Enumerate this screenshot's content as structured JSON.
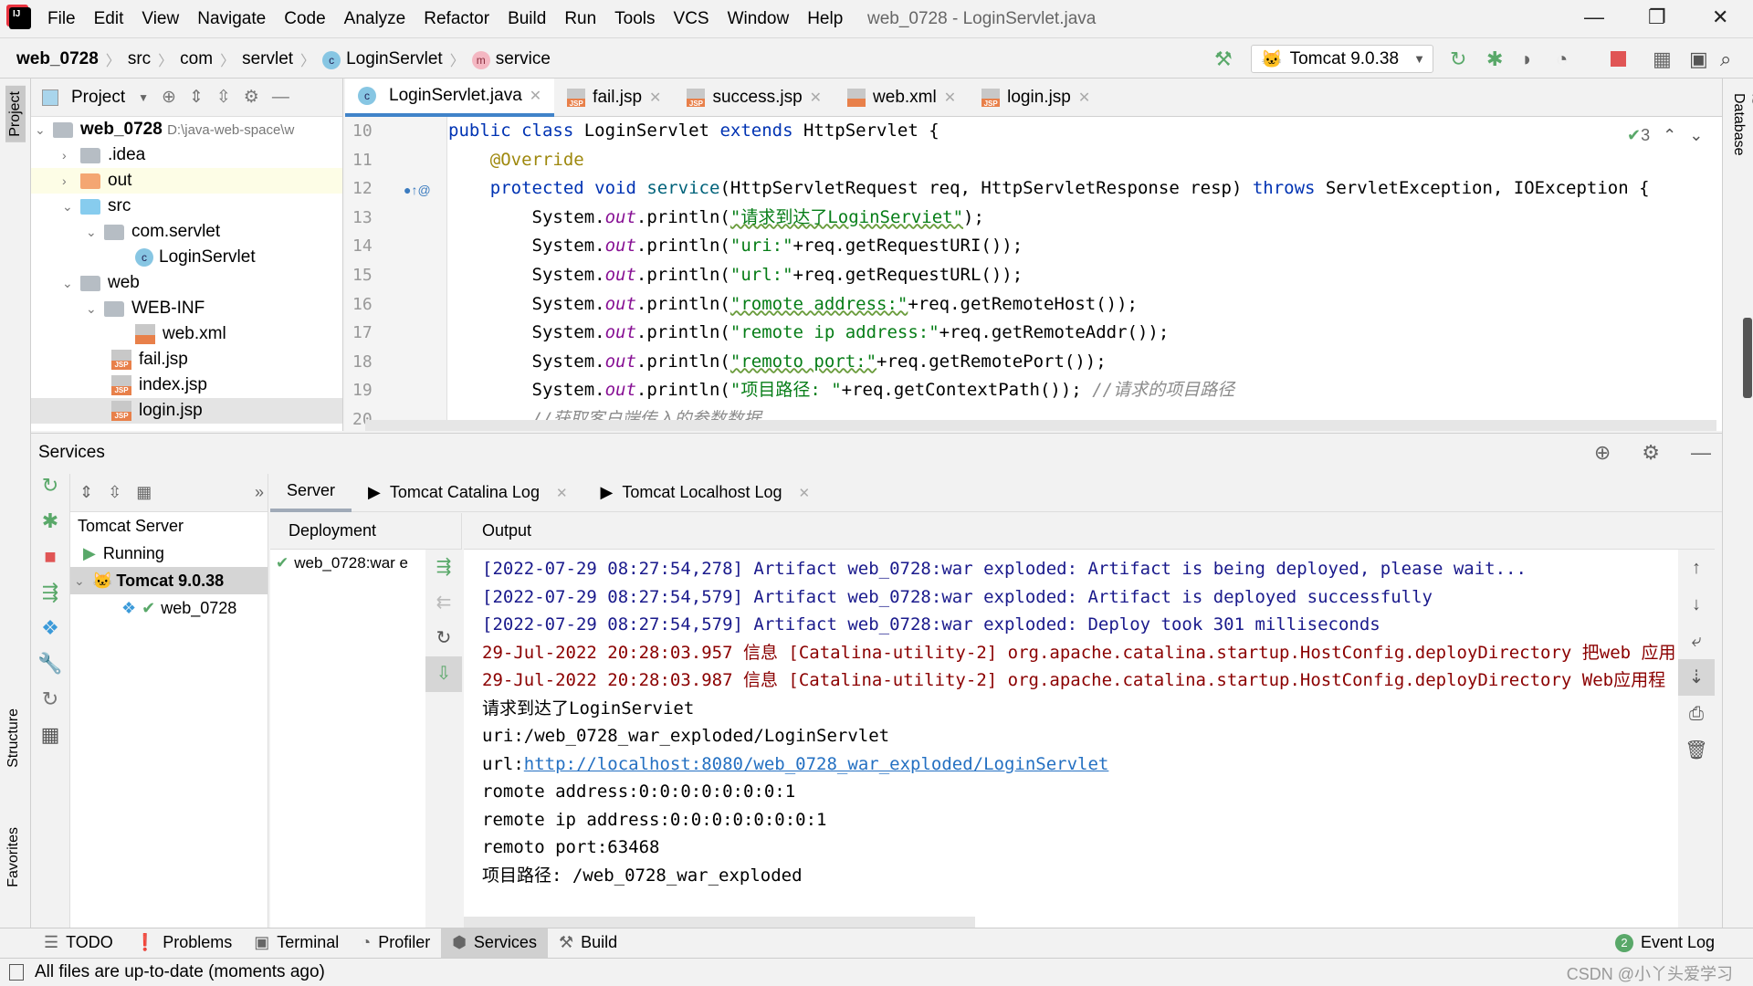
{
  "window": {
    "title": "web_0728 - LoginServlet.java"
  },
  "menu": [
    "File",
    "Edit",
    "View",
    "Navigate",
    "Code",
    "Analyze",
    "Refactor",
    "Build",
    "Run",
    "Tools",
    "VCS",
    "Window",
    "Help"
  ],
  "breadcrumb": [
    "web_0728",
    "src",
    "com",
    "servlet",
    "LoginServlet",
    "service"
  ],
  "run_config": "Tomcat 9.0.38",
  "project": {
    "header": "Project",
    "root": "web_0728",
    "root_path": "D:\\java-web-space\\w",
    "items": [
      ".idea",
      "out",
      "src",
      "com.servlet",
      "LoginServlet",
      "web",
      "WEB-INF",
      "web.xml",
      "fail.jsp",
      "index.jsp",
      "login.jsp"
    ]
  },
  "editor": {
    "tabs": [
      "LoginServlet.java",
      "fail.jsp",
      "success.jsp",
      "web.xml",
      "login.jsp"
    ],
    "inspection_count": "3",
    "line_numbers": [
      "10",
      "11",
      "12",
      "13",
      "14",
      "15",
      "16",
      "17",
      "18",
      "19",
      "20"
    ],
    "lines": [
      [
        [
          "kw",
          "public class "
        ],
        [
          "",
          "LoginServlet "
        ],
        [
          "kw",
          "extends "
        ],
        [
          "",
          "HttpServlet {"
        ]
      ],
      [
        [
          "",
          "    "
        ],
        [
          "ann",
          "@Override"
        ]
      ],
      [
        [
          "",
          "    "
        ],
        [
          "kw",
          "protected void "
        ],
        [
          "fn",
          "service"
        ],
        [
          "",
          "(HttpServletRequest req, HttpServletResponse resp) "
        ],
        [
          "kw",
          "throws "
        ],
        [
          "",
          "ServletException, IOException {"
        ]
      ],
      [
        [
          "",
          "        System."
        ],
        [
          "fld",
          "out"
        ],
        [
          "",
          ".println("
        ],
        [
          "st",
          "\"请求到达了LoginServiet\""
        ],
        [
          "",
          ");"
        ]
      ],
      [
        [
          "",
          "        System."
        ],
        [
          "fld",
          "out"
        ],
        [
          "",
          ".println("
        ],
        [
          "st",
          "\"uri:\""
        ],
        [
          "",
          "+req.getRequestURI());"
        ]
      ],
      [
        [
          "",
          "        System."
        ],
        [
          "fld",
          "out"
        ],
        [
          "",
          ".println("
        ],
        [
          "st",
          "\"url:\""
        ],
        [
          "",
          "+req.getRequestURL());"
        ]
      ],
      [
        [
          "",
          "        System."
        ],
        [
          "fld",
          "out"
        ],
        [
          "",
          ".println("
        ],
        [
          "st",
          "\"romote address:\""
        ],
        [
          "",
          "+req.getRemoteHost());"
        ]
      ],
      [
        [
          "",
          "        System."
        ],
        [
          "fld",
          "out"
        ],
        [
          "",
          ".println("
        ],
        [
          "st",
          "\"remote ip address:\""
        ],
        [
          "",
          "+req.getRemoteAddr());"
        ]
      ],
      [
        [
          "",
          "        System."
        ],
        [
          "fld",
          "out"
        ],
        [
          "",
          ".println("
        ],
        [
          "st",
          "\"remoto port:\""
        ],
        [
          "",
          "+req.getRemotePort());"
        ]
      ],
      [
        [
          "",
          "        System."
        ],
        [
          "fld",
          "out"
        ],
        [
          "",
          ".println("
        ],
        [
          "st",
          "\"项目路径: \""
        ],
        [
          "",
          "+req.getContextPath()); "
        ],
        [
          "cm",
          "//请求的项目路径"
        ]
      ],
      [
        [
          "",
          "        "
        ],
        [
          "cm",
          "//获取客户端传入的参数数据"
        ]
      ]
    ]
  },
  "side": {
    "left_top": "Project",
    "structure": "Structure",
    "favorites": "Favorites",
    "right": "Database"
  },
  "services": {
    "title": "Services",
    "tree": [
      "Tomcat Server",
      "Running",
      "Tomcat 9.0.38",
      "web_0728"
    ],
    "tabs": [
      "Server",
      "Tomcat Catalina Log",
      "Tomcat Localhost Log"
    ],
    "deployment_header": "Deployment",
    "deployment_item": "web_0728:war e",
    "output_header": "Output",
    "output": [
      {
        "kind": "sys",
        "text": "[2022-07-29 08:27:54,278] Artifact web_0728:war exploded: Artifact is being deployed, please wait..."
      },
      {
        "kind": "sys",
        "text": "[2022-07-29 08:27:54,579] Artifact web_0728:war exploded: Artifact is deployed successfully"
      },
      {
        "kind": "sys",
        "text": "[2022-07-29 08:27:54,579] Artifact web_0728:war exploded: Deploy took 301 milliseconds"
      },
      {
        "kind": "info",
        "text": "29-Jul-2022 20:28:03.957 信息 [Catalina-utility-2] org.apache.catalina.startup.HostConfig.deployDirectory 把web 应用"
      },
      {
        "kind": "info",
        "text": "29-Jul-2022 20:28:03.987 信息 [Catalina-utility-2] org.apache.catalina.startup.HostConfig.deployDirectory Web应用程"
      },
      {
        "kind": "plain",
        "text": "请求到达了LoginServiet"
      },
      {
        "kind": "plain",
        "text": "uri:/web_0728_war_exploded/LoginServlet"
      },
      {
        "kind": "plain",
        "text": "url:",
        "link": "http://localhost:8080/web_0728_war_exploded/LoginServlet"
      },
      {
        "kind": "plain",
        "text": "romote address:0:0:0:0:0:0:0:1"
      },
      {
        "kind": "plain",
        "text": "remote ip address:0:0:0:0:0:0:0:1"
      },
      {
        "kind": "plain",
        "text": "remoto port:63468"
      },
      {
        "kind": "plain",
        "text": "项目路径: /web_0728_war_exploded"
      }
    ]
  },
  "bottom_tools": [
    "TODO",
    "Problems",
    "Terminal",
    "Profiler",
    "Services",
    "Build"
  ],
  "event_log": {
    "label": "Event Log",
    "count": "2"
  },
  "status": "All files are up-to-date (moments ago)",
  "watermark": "CSDN @小丫头爱学习",
  "colors": {
    "accent": "#4083c9",
    "keyword": "#0033b3",
    "string": "#067d17",
    "stop": "#e05555",
    "run": "#59a869"
  }
}
